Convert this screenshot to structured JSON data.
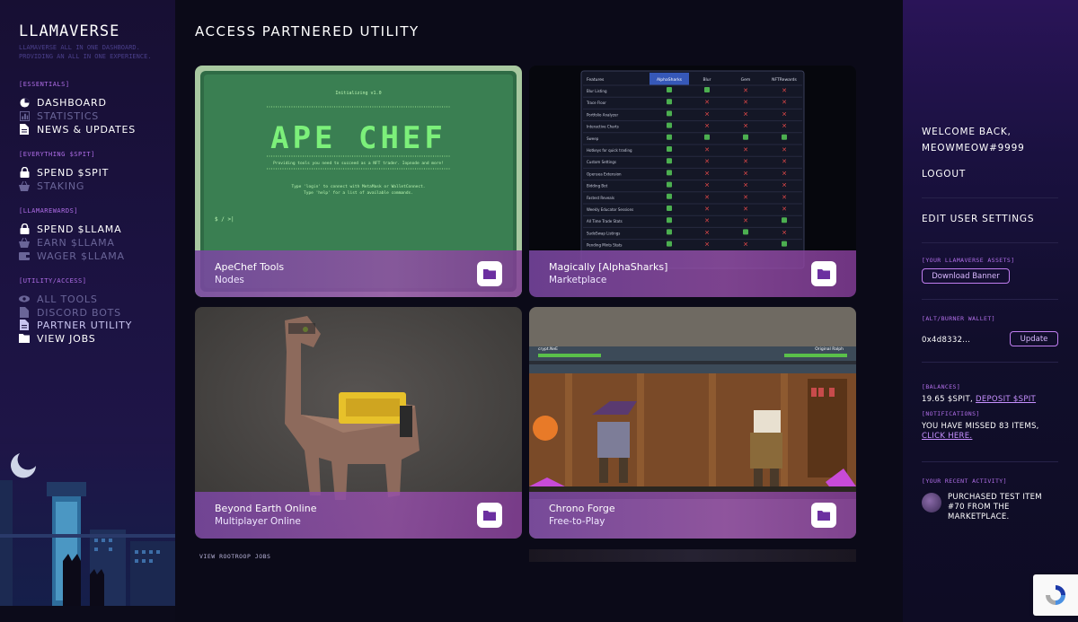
{
  "brand": {
    "name": "LLAMAVERSE",
    "tagline": "LLAMAVERSE ALL IN ONE DASHBOARD. PROVIDING AN ALL IN ONE EXPERIENCE."
  },
  "nav": {
    "essentials": {
      "title": "[ESSENTIALS]",
      "items": [
        {
          "label": "DASHBOARD",
          "icon": "dashboard-icon"
        },
        {
          "label": "STATISTICS",
          "icon": "chart-icon"
        },
        {
          "label": "NEWS & UPDATES",
          "icon": "document-icon"
        }
      ]
    },
    "spit": {
      "title": "[EVERYTHING $SPIT]",
      "items": [
        {
          "label": "SPEND $SPIT",
          "icon": "lock-icon"
        },
        {
          "label": "STAKING",
          "icon": "basket-icon"
        }
      ]
    },
    "rewards": {
      "title": "[LLAMAREWARDS]",
      "items": [
        {
          "label": "SPEND $LLAMA",
          "icon": "lock-icon"
        },
        {
          "label": "EARN $LLAMA",
          "icon": "basket-icon"
        },
        {
          "label": "WAGER $LLAMA",
          "icon": "wallet-icon"
        }
      ]
    },
    "utility": {
      "title": "[UTILITY/ACCESS]",
      "items": [
        {
          "label": "ALL TOOLS",
          "icon": "eye-icon"
        },
        {
          "label": "DISCORD BOTS",
          "icon": "bot-icon"
        },
        {
          "label": "PARTNER UTILITY",
          "icon": "document-icon"
        },
        {
          "label": "VIEW JOBS",
          "icon": "folder-icon"
        }
      ]
    }
  },
  "main": {
    "title": "ACCESS PARTNERED UTILITY",
    "cards": [
      {
        "title": "ApeChef Tools",
        "subtitle": "Nodes",
        "art": {
          "header": "Initializing v1.0",
          "logo": "APE CHEF",
          "tagline": "Providing tools you need to succeed as a NFT trader. Iopnode and more!",
          "hint1": "Type 'login' to connect with MetaMask or WalletConnect.",
          "hint2": "Type 'help' for a list of available commands.",
          "prompt": "$ / >|"
        }
      },
      {
        "title": "Magically [AlphaSharks]",
        "subtitle": "Marketplace",
        "art": {
          "columns": [
            "Features",
            "AlphaSharks",
            "Blur",
            "Gem",
            "NFTRewards"
          ],
          "rows": [
            "Blur Listing",
            "Trace Floor",
            "Portfolio Analyzer",
            "Interactive Charts",
            "Sweep",
            "Hotkeys for quick trading",
            "Custom Settings",
            "Opensea Extension",
            "Bidding Bot",
            "Fastest Reveals",
            "Weekly Educator Sessions",
            "All Time Trade Stats",
            "SudoSwap Listings",
            "Pending Mints Stats"
          ]
        }
      },
      {
        "title": "Beyond Earth Online",
        "subtitle": "Multiplayer Online"
      },
      {
        "title": "Chrono Forge",
        "subtitle": "Free-to-Play",
        "art": {
          "left_name": "crypt.NeE",
          "right_name": "Original Ralph"
        }
      }
    ],
    "view_jobs": "VIEW ROOTROOP JOBS"
  },
  "account": {
    "welcome": "WELCOME BACK,",
    "username": "MEOWMEOW#9999",
    "logout": "LOGOUT",
    "edit_settings": "EDIT USER SETTINGS",
    "assets_title": "[YOUR LLAMAVERSE ASSETS]",
    "download_banner": "Download Banner",
    "wallet_title": "[ALT/BURNER WALLET]",
    "wallet_address": "0x4d8332...",
    "update": "Update",
    "balances_title": "[BALANCES]",
    "balance_value": "19.65 $SPIT,",
    "deposit_link": "DEPOSIT $SPIT",
    "notifications_title": "[NOTIFICATIONS]",
    "notification_text": "YOU HAVE MISSED 83 ITEMS,",
    "notification_link": "CLICK HERE.",
    "activity_title": "[YOUR RECENT ACTIVITY]",
    "activity_text": "PURCHASED TEST ITEM #70 FROM THE MARKETPLACE."
  },
  "colors": {
    "accent": "#b06ee8",
    "background": "#0b0a18",
    "sidebar": "#1b1240"
  }
}
